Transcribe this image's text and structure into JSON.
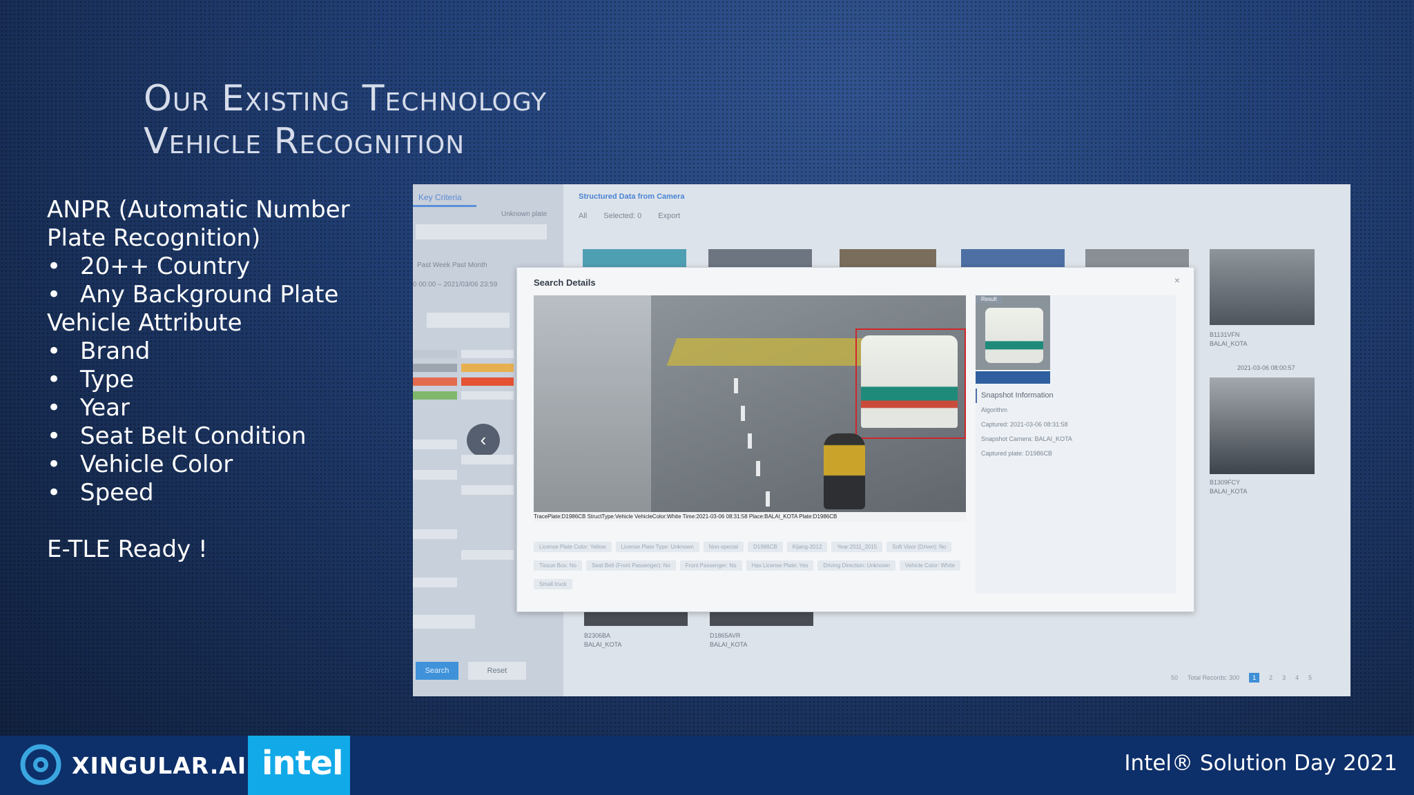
{
  "slide": {
    "title_line1": "Our Existing Technology",
    "title_line2": "Vehicle Recognition",
    "section1": "ANPR (Automatic Number",
    "section1_cont": "Plate Recognition)",
    "section1_items": [
      "20++ Country",
      "Any Background Plate"
    ],
    "section2": "Vehicle Attribute",
    "section2_items": [
      "Brand",
      "Type",
      "Year",
      "Seat Belt Condition",
      "Vehicle Color",
      "Speed"
    ],
    "tagline": "E-TLE Ready !"
  },
  "screenshot": {
    "left_tab": "Key Criteria",
    "unknown_plate": "Unknown plate",
    "time_tabs": "Past Week    Past Month",
    "time_range": "0 00:00 – 2021/03/06 23:59",
    "search_label": "Search",
    "reset_label": "Reset",
    "header": "Structured Data from Camera",
    "tool_all": "All",
    "tool_selected": "Selected: 0",
    "tool_export": "Export",
    "modal_title": "Search Details",
    "result_tag": "Result",
    "info_header": "Snapshot Information",
    "info_rows": [
      "Algorithm",
      "Captured:   2021-03-06 08:31:58",
      "Snapshot Camera:   BALAI_KOTA",
      "Captured plate:   D1986CB"
    ],
    "meta_line": "TracePlate:D1986CB  StructType:Vehicle  VehicleColor:White  Time:2021-03-06 08:31:58  Place:BALAI_KOTA  Plate:D1986CB",
    "chips": [
      "License Plate Color: Yellow",
      "License Plate Type: Unknown",
      "Non-special",
      "D1986CB",
      "Kijang-2012",
      "Year:2011_2015",
      "Soft Visor (Driver): No",
      "Tissue Box: No",
      "Seat Belt (Front Passenger): No",
      "Front Passenger: No",
      "Has License Plate: Yes",
      "Driving Direction: Unknown",
      "Vehicle Color: White",
      "Small truck"
    ],
    "captions": [
      "B1131VFN\nBALAI_KOTA",
      "2021-03-06 08:00:57",
      "B1309FCY\nBALAI_KOTA",
      "B2306BA\nBALAI_KOTA",
      "D1865AVR\nBALAI_KOTA"
    ],
    "pager_size": "50",
    "pager_total": "Total Records: 300",
    "pages": [
      "1",
      "2",
      "3",
      "4",
      "5"
    ]
  },
  "footer": {
    "brand": "XINGULAR.AI",
    "partner": "intel",
    "event": "Intel® Solution Day 2021"
  },
  "colors": {
    "accent_blue": "#12a9e8",
    "footer_bg": "#0d2f6a",
    "bbox_red": "#d0262a"
  }
}
